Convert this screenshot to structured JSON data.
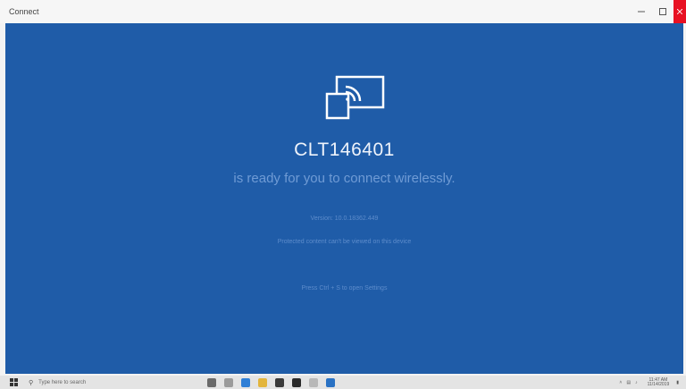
{
  "window": {
    "title": "Connect",
    "controls": {
      "minimize_icon": "minimize-icon",
      "restore_icon": "restore-icon",
      "close_icon": "close-icon"
    }
  },
  "main": {
    "icon": "cast-screen-icon",
    "device_name": "CLT146401",
    "ready_message": "is ready for you to connect wirelessly.",
    "version": "Version: 10.0.18362.449",
    "protected_notice": "Protected content can't be viewed on this device",
    "settings_hint": "Press Ctrl + S to open Settings"
  },
  "taskbar": {
    "search_placeholder": "Type here to search",
    "apps": [
      {
        "name": "task-view-icon",
        "color": "#6a6a6a"
      },
      {
        "name": "file-explorer-icon",
        "color": "#9b9b9b"
      },
      {
        "name": "edge-icon",
        "color": "#2f7fd6"
      },
      {
        "name": "folder-icon",
        "color": "#e3b53c"
      },
      {
        "name": "camera-icon",
        "color": "#3a3a3a"
      },
      {
        "name": "mail-icon",
        "color": "#2b2b2b"
      },
      {
        "name": "store-icon",
        "color": "#b8b8b8"
      },
      {
        "name": "connect-app-icon",
        "color": "#2a72c4"
      }
    ],
    "clock": {
      "time": "11:47 AM",
      "date": "11/14/2019"
    }
  },
  "colors": {
    "background_blue": "#1f5ca8",
    "close_red": "#e81123"
  }
}
